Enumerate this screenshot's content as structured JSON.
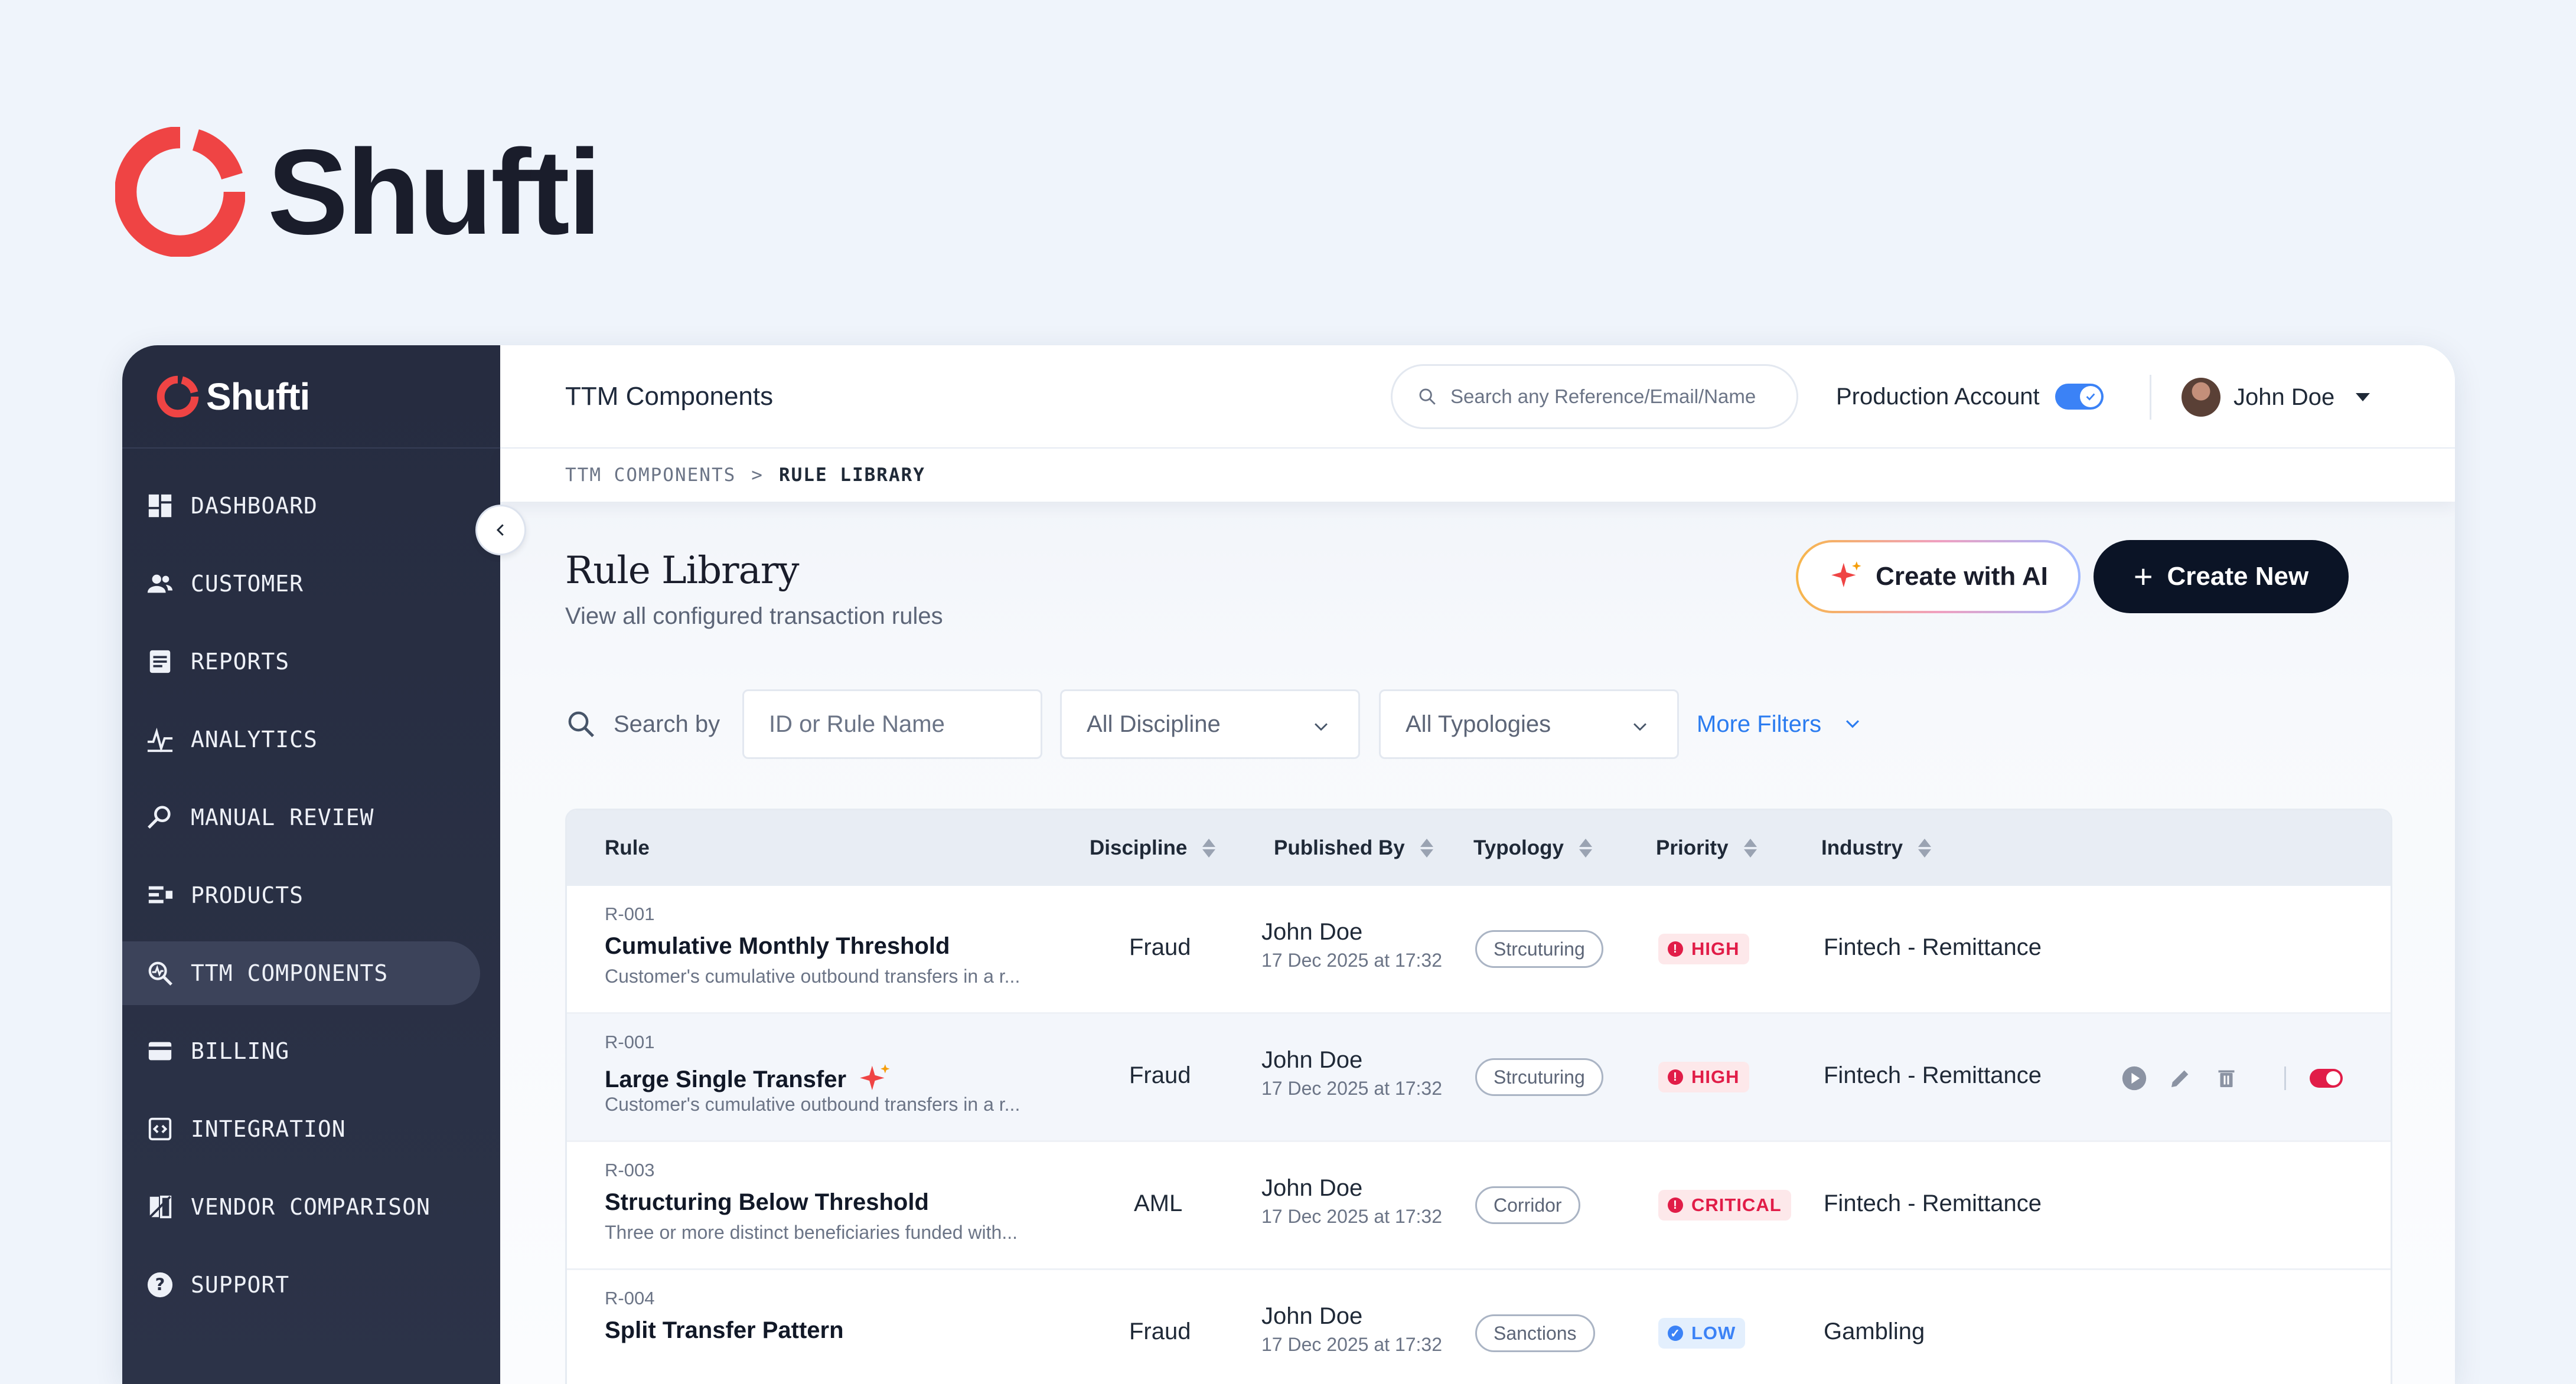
{
  "brand": {
    "name": "Shufti"
  },
  "sidebar": {
    "logo": "Shufti",
    "items": [
      {
        "label": "DASHBOARD",
        "icon": "dashboard-icon"
      },
      {
        "label": "CUSTOMER",
        "icon": "users-icon"
      },
      {
        "label": "REPORTS",
        "icon": "reports-icon"
      },
      {
        "label": "ANALYTICS",
        "icon": "analytics-icon"
      },
      {
        "label": "MANUAL REVIEW",
        "icon": "manual-review-icon"
      },
      {
        "label": "PRODUCTS",
        "icon": "products-icon"
      },
      {
        "label": "TTM COMPONENTS",
        "icon": "ttm-components-icon",
        "active": true
      },
      {
        "label": "BILLING",
        "icon": "billing-icon"
      },
      {
        "label": "INTEGRATION",
        "icon": "integration-icon"
      },
      {
        "label": "VENDOR COMPARISON",
        "icon": "vendor-comparison-icon"
      },
      {
        "label": "SUPPORT",
        "icon": "support-icon"
      }
    ]
  },
  "topbar": {
    "title": "TTM Components",
    "search_placeholder": "Search any Reference/Email/Name",
    "production_label": "Production Account",
    "production_on": true,
    "user_name": "John Doe"
  },
  "breadcrumb": {
    "parent": "TTM COMPONENTS",
    "separator": ">",
    "current": "RULE LIBRARY"
  },
  "page": {
    "title": "Rule Library",
    "subtitle": "View all configured transaction rules",
    "create_ai_label": "Create with AI",
    "create_new_label": "Create New"
  },
  "filters": {
    "search_label": "Search by",
    "search_placeholder": "ID or Rule Name",
    "discipline": "All Discipline",
    "typologies": "All Typologies",
    "more": "More Filters"
  },
  "table": {
    "headers": {
      "rule": "Rule",
      "discipline": "Discipline",
      "published_by": "Published By",
      "typology": "Typology",
      "priority": "Priority",
      "industry": "Industry"
    },
    "rows": [
      {
        "id": "R-001",
        "name": "Cumulative Monthly Threshold",
        "ai": false,
        "desc": "Customer's cumulative outbound transfers in a r...",
        "discipline": "Fraud",
        "pub_name": "John Doe",
        "pub_date": "17 Dec 2025 at 17:32",
        "typology": "Strcuturing",
        "priority": "HIGH",
        "priority_color": "red",
        "industry": "Fintech - Remittance",
        "actions": false
      },
      {
        "id": "R-001",
        "name": "Large Single Transfer",
        "ai": true,
        "desc": "Customer's cumulative outbound transfers in a r...",
        "discipline": "Fraud",
        "pub_name": "John Doe",
        "pub_date": "17 Dec 2025 at 17:32",
        "typology": "Strcuturing",
        "priority": "HIGH",
        "priority_color": "red",
        "industry": "Fintech - Remittance",
        "actions": true
      },
      {
        "id": "R-003",
        "name": "Structuring Below Threshold",
        "ai": false,
        "desc": "Three or more distinct beneficiaries funded with...",
        "discipline": "AML",
        "pub_name": "John Doe",
        "pub_date": "17 Dec 2025 at 17:32",
        "typology": "Corridor",
        "priority": "CRITICAL",
        "priority_color": "red",
        "industry": "Fintech - Remittance",
        "actions": false
      },
      {
        "id": "R-004",
        "name": "Split Transfer Pattern",
        "ai": false,
        "desc": "",
        "discipline": "Fraud",
        "pub_name": "John Doe",
        "pub_date": "17 Dec 2025 at 17:32",
        "typology": "Sanctions",
        "priority": "LOW",
        "priority_color": "blue",
        "industry": "Gambling",
        "actions": false
      }
    ]
  },
  "colors": {
    "accent_red": "#ef4444",
    "brand_navy": "#0b1426",
    "link_blue": "#2b7cf0",
    "sidebar_bg": "#262c40"
  }
}
